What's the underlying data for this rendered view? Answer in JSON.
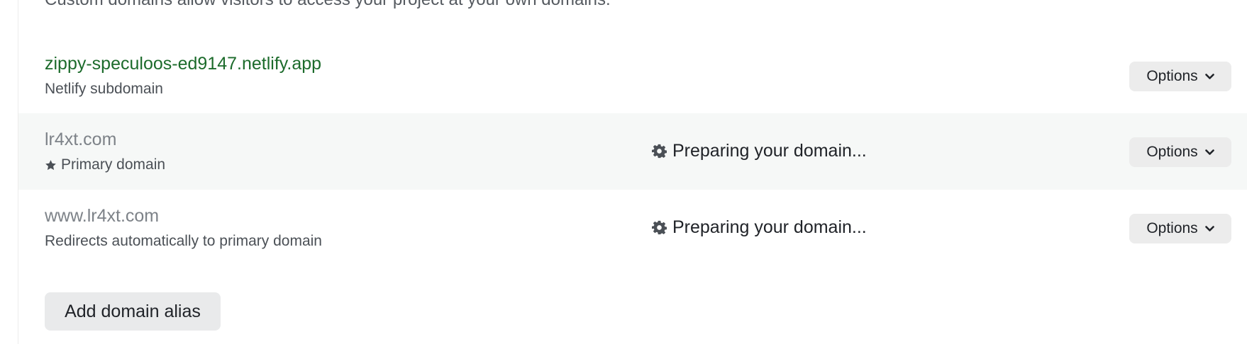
{
  "description": "Custom domains allow visitors to access your project at your own domains.",
  "domains": [
    {
      "name": "zippy-speculoos-ed9147.netlify.app",
      "subtitle": "Netlify subdomain",
      "status": "",
      "options_label": "Options"
    },
    {
      "name": "lr4xt.com",
      "subtitle": "Primary domain",
      "status": "Preparing your domain...",
      "options_label": "Options"
    },
    {
      "name": "www.lr4xt.com",
      "subtitle": "Redirects automatically to primary domain",
      "status": "Preparing your domain...",
      "options_label": "Options"
    }
  ],
  "add_alias_label": "Add domain alias",
  "colors": {
    "netlify_domain": "#1c6b2b",
    "custom_domain": "#7d8288",
    "row_highlight": "#f6f8f7",
    "button_bg": "#ececec"
  },
  "icons": {
    "primary_marker": "star-icon",
    "status_marker": "gear-icon",
    "options_marker": "chevron-down-icon"
  }
}
